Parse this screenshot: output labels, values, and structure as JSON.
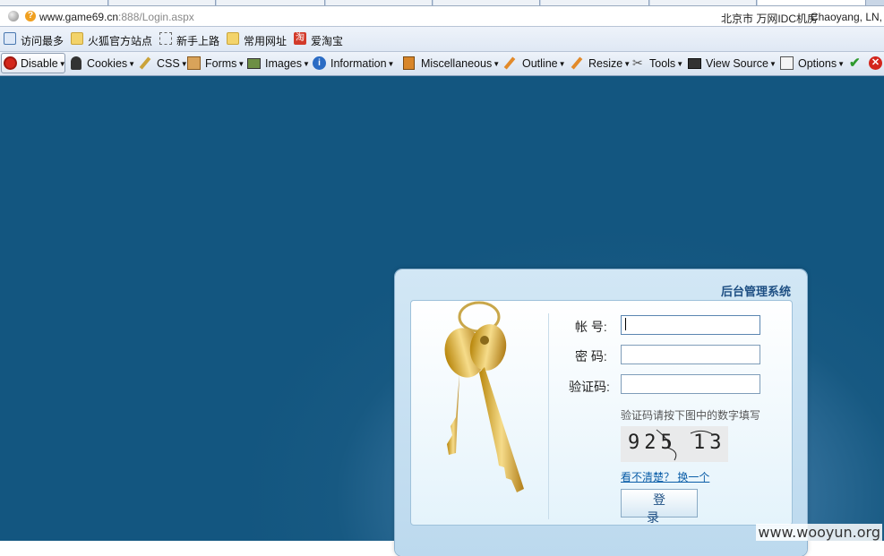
{
  "browser": {
    "url_domain": "www.game69.cn",
    "url_rest": ":888/Login.aspx",
    "location_city": "北京市 万网IDC机房",
    "location_region": "Chaoyang, LN,"
  },
  "bookmarks": [
    {
      "label": "访问最多",
      "icon": "frequent-icon"
    },
    {
      "label": "火狐官方站点",
      "icon": "folder-icon"
    },
    {
      "label": "新手上路",
      "icon": "dashed-folder-icon"
    },
    {
      "label": "常用网址",
      "icon": "folder-icon"
    },
    {
      "label": "爱淘宝",
      "icon": "taobao-icon"
    }
  ],
  "devtoolbar": [
    {
      "label": "Disable",
      "icon": "disable-icon"
    },
    {
      "label": "Cookies",
      "icon": "cookie-user-icon"
    },
    {
      "label": "CSS",
      "icon": "css-pen-icon"
    },
    {
      "label": "Forms",
      "icon": "forms-clipboard-icon"
    },
    {
      "label": "Images",
      "icon": "image-icon"
    },
    {
      "label": "Information",
      "icon": "info-icon"
    },
    {
      "label": "Miscellaneous",
      "icon": "misc-book-icon"
    },
    {
      "label": "Outline",
      "icon": "outline-pencil-icon"
    },
    {
      "label": "Resize",
      "icon": "resize-pencil-icon"
    },
    {
      "label": "Tools",
      "icon": "tools-icon"
    },
    {
      "label": "View Source",
      "icon": "source-monitor-icon"
    },
    {
      "label": "Options",
      "icon": "options-icon"
    }
  ],
  "login": {
    "panel_title": "后台管理系统",
    "account_label": "帐  号:",
    "password_label": "密  码:",
    "captcha_label": "验证码:",
    "account_value": "",
    "password_value": "",
    "captcha_value": "",
    "captcha_hint": "验证码请按下图中的数字填写",
    "captcha_text": "925 13",
    "refresh_link": "看不清楚？ 换一个",
    "login_button": "登 录"
  },
  "watermark": "www.wooyun.org",
  "colors": {
    "background": "#135680",
    "panel_title": "#1e4f83",
    "link": "#0b5ea8"
  }
}
